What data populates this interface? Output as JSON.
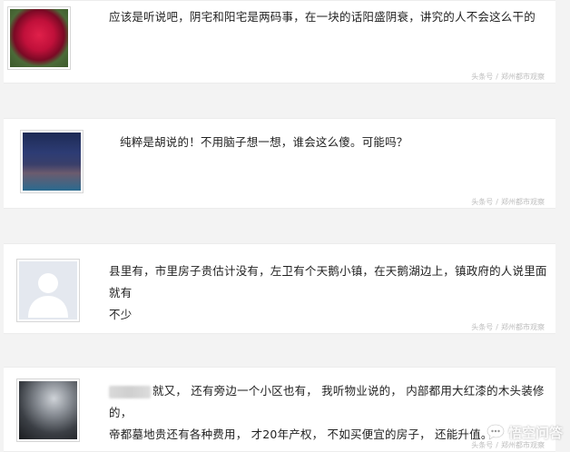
{
  "comments": [
    {
      "text": "应该是听说吧，阴宅和阳宅是两码事，在一块的话阳盛阴衰，讲究的人不会这么干的",
      "source": "头条号",
      "source_name": "郑州都市观察"
    },
    {
      "text": "纯粹是胡说的！不用脑子想一想，谁会这么傻。可能吗？",
      "source": "头条号",
      "source_name": "郑州都市观察"
    },
    {
      "text_line1": "县里有，市里房子贵估计没有，左卫有个天鹅小镇，在天鹅湖边上，镇政府的人说里面就有",
      "text_line2": "不少",
      "source": "头条号",
      "source_name": "郑州都市观察"
    },
    {
      "text_line1": "就又， 还有旁边一个小区也有， 我听物业说的， 内部都用大红漆的木头装修的，",
      "text_line2": "帝都墓地贵还有各种费用， 才20年产权， 不如买便宜的房子， 还能升值。",
      "source": "头条号",
      "source_name": "郑州都市观察"
    }
  ],
  "watermark": {
    "text": "悟空问答",
    "icon": "chat-bubble-icon"
  }
}
